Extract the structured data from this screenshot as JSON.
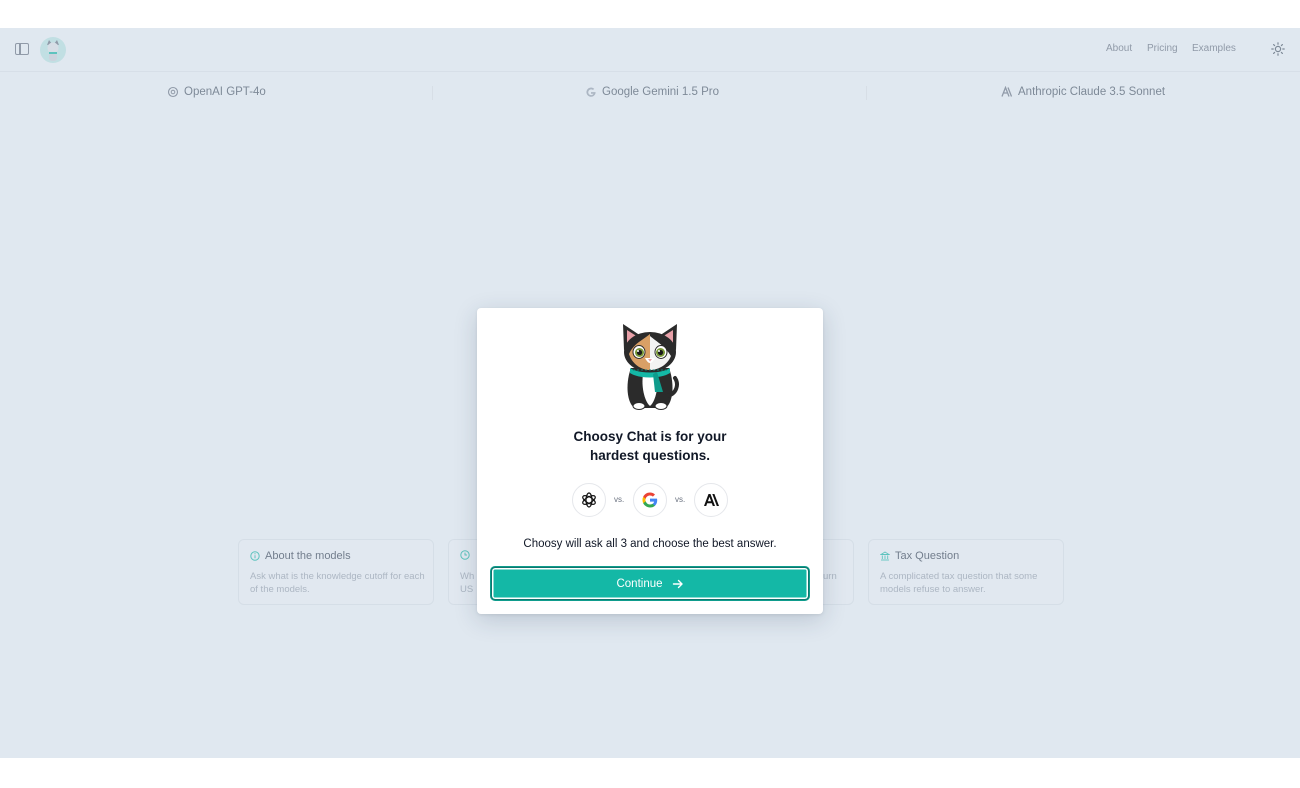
{
  "nav": {
    "about": "About",
    "pricing": "Pricing",
    "examples": "Examples"
  },
  "models": [
    {
      "label": "OpenAI GPT-4o",
      "icon": "openai-icon"
    },
    {
      "label": "Google Gemini 1.5 Pro",
      "icon": "google-icon"
    },
    {
      "label": "Anthropic Claude 3.5 Sonnet",
      "icon": "anthropic-icon"
    }
  ],
  "cards": [
    {
      "title": "About the models",
      "desc": "Ask what is the knowledge cutoff for each of the models.",
      "icon": "info-icon"
    },
    {
      "title": "",
      "desc": "Wh",
      "desc2": "US",
      "icon": "clock-icon"
    },
    {
      "title": "",
      "desc": "urn",
      "icon": ""
    },
    {
      "title": "Tax Question",
      "desc": "A complicated tax question that some models refuse to answer.",
      "icon": "bank-icon"
    }
  ],
  "modal": {
    "title_line1": "Choosy Chat is for your",
    "title_line2": "hardest questions.",
    "vs1": "vs.",
    "vs2": "vs.",
    "subtitle": "Choosy will ask all 3 and choose the best answer.",
    "continue_label": "Continue"
  },
  "colors": {
    "accent": "#14b8a6",
    "background": "#f5f8fb"
  }
}
